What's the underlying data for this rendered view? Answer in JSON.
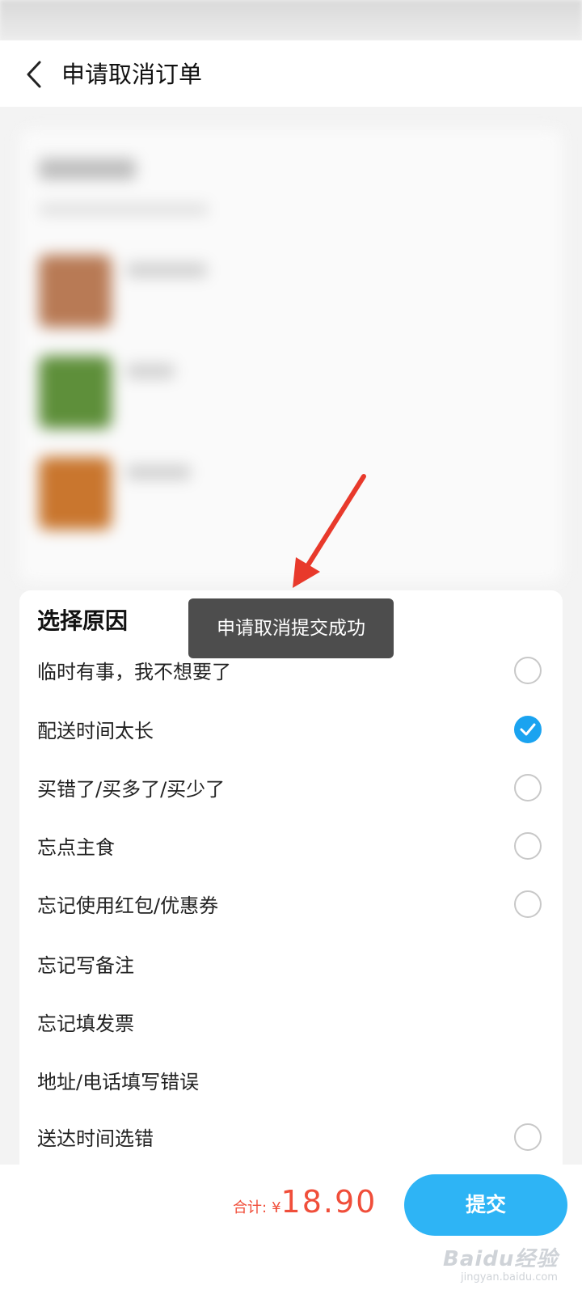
{
  "header": {
    "title": "申请取消订单",
    "back_icon": "chevron-left-icon"
  },
  "reasons": {
    "title": "选择原因",
    "items": [
      {
        "label": "临时有事，我不想要了",
        "selected": false,
        "has_radio": true
      },
      {
        "label": "配送时间太长",
        "selected": true,
        "has_radio": true
      },
      {
        "label": "买错了/买多了/买少了",
        "selected": false,
        "has_radio": true
      },
      {
        "label": "忘点主食",
        "selected": false,
        "has_radio": true
      },
      {
        "label": "忘记使用红包/优惠券",
        "selected": false,
        "has_radio": true
      },
      {
        "label": "忘记写备注",
        "selected": false,
        "has_radio": false
      },
      {
        "label": "忘记填发票",
        "selected": false,
        "has_radio": false
      },
      {
        "label": "地址/电话填写错误",
        "selected": false,
        "has_radio": false
      },
      {
        "label": "送达时间选错",
        "selected": false,
        "has_radio": true
      }
    ]
  },
  "toast": {
    "message": "申请取消提交成功"
  },
  "footer": {
    "total_label": "合计:",
    "currency": "¥",
    "amount": "18.90",
    "submit_label": "提交"
  },
  "watermark": {
    "main": "Baidu经验",
    "sub": "jingyan.baidu.com"
  },
  "colors": {
    "accent": "#2eb4f5",
    "price": "#f04e3a",
    "annotation_arrow": "#e8392b"
  }
}
